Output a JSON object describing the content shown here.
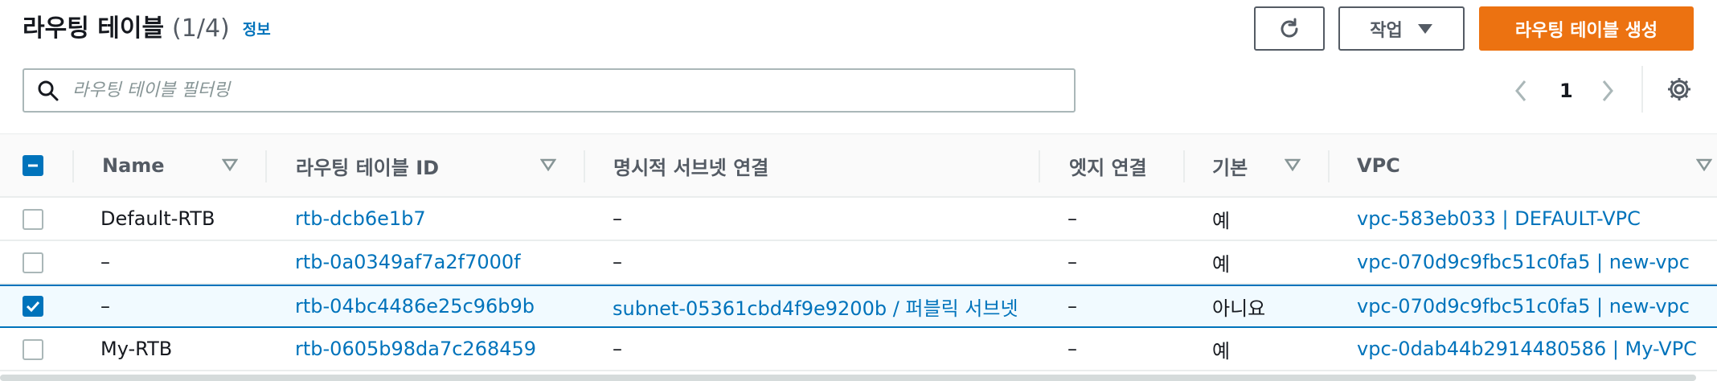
{
  "header": {
    "title": "라우팅 테이블",
    "count": "(1/4)",
    "info_link": "정보",
    "refresh_icon": "refresh-icon",
    "actions_label": "작업",
    "create_label": "라우팅 테이블 생성"
  },
  "filter": {
    "placeholder": "라우팅 테이블 필터링"
  },
  "pagination": {
    "current_page": "1"
  },
  "columns": [
    {
      "key": "name",
      "label": "Name",
      "sortable": true
    },
    {
      "key": "id",
      "label": "라우팅 테이블 ID",
      "sortable": true
    },
    {
      "key": "subnet",
      "label": "명시적 서브넷 연결",
      "sortable": false
    },
    {
      "key": "edge",
      "label": "엣지 연결",
      "sortable": false
    },
    {
      "key": "main",
      "label": "기본",
      "sortable": true
    },
    {
      "key": "vpc",
      "label": "VPC",
      "sortable": true
    }
  ],
  "rows": [
    {
      "checked": false,
      "name": "Default-RTB",
      "id": "rtb-dcb6e1b7",
      "subnet": "–",
      "edge": "–",
      "main": "예",
      "vpc": "vpc-583eb033 | DEFAULT-VPC"
    },
    {
      "checked": false,
      "name": "–",
      "id": "rtb-0a0349af7a2f7000f",
      "subnet": "–",
      "edge": "–",
      "main": "예",
      "vpc": "vpc-070d9c9fbc51c0fa5 | new-vpc"
    },
    {
      "checked": true,
      "name": "–",
      "id": "rtb-04bc4486e25c96b9b",
      "subnet": "subnet-05361cbd4f9e9200b / 퍼블릭 서브넷",
      "edge": "–",
      "main": "아니요",
      "vpc": "vpc-070d9c9fbc51c0fa5 | new-vpc"
    },
    {
      "checked": false,
      "name": "My-RTB",
      "id": "rtb-0605b98da7c268459",
      "subnet": "–",
      "edge": "–",
      "main": "예",
      "vpc": "vpc-0dab44b2914480586 | My-VPC"
    }
  ],
  "colors": {
    "accent": "#0073bb",
    "primary_button": "#ec7211",
    "text": "#16191f",
    "muted": "#545b64"
  }
}
